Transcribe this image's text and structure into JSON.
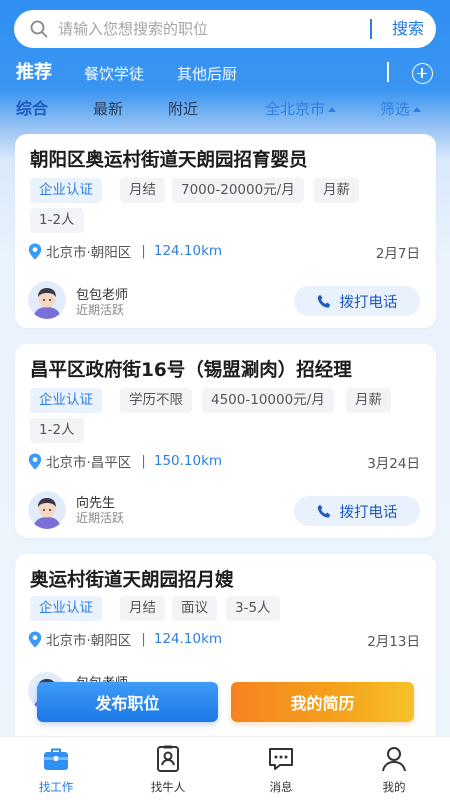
{
  "search": {
    "placeholder": "请输入您想搜索的职位",
    "button_label": "搜索"
  },
  "categories": [
    {
      "label": "推荐",
      "active": true
    },
    {
      "label": "餐饮学徒",
      "active": false
    },
    {
      "label": "其他后厨",
      "active": false
    }
  ],
  "filters": {
    "tabs": [
      "综合",
      "最新",
      "附近"
    ],
    "active_tab": "综合",
    "city": "全北京市",
    "screen": "筛选"
  },
  "jobs": [
    {
      "title": "朝阳区奥运村街道天朗园招育婴员",
      "tags": [
        "企业认证",
        "月结",
        "7000-20000元/月",
        "月薪",
        "1-2人"
      ],
      "location": "北京市·朝阳区",
      "distance": "124.10km",
      "date": "2月7日",
      "contact_name": "包包老师",
      "contact_status": "近期活跃",
      "call_label": "拨打电话"
    },
    {
      "title": "昌平区政府街16号（锡盟涮肉）招经理",
      "tags": [
        "企业认证",
        "学历不限",
        "4500-10000元/月",
        "月薪",
        "1-2人"
      ],
      "location": "北京市·昌平区",
      "distance": "150.10km",
      "date": "3月24日",
      "contact_name": "向先生",
      "contact_status": "近期活跃",
      "call_label": "拨打电话"
    },
    {
      "title": "奥运村街道天朗园招月嫂",
      "tags": [
        "企业认证",
        "月结",
        "面议",
        "3-5人"
      ],
      "location": "北京市·朝阳区",
      "distance": "124.10km",
      "date": "2月13日",
      "contact_name": "包包老师",
      "contact_status": "",
      "call_label": ""
    }
  ],
  "actions": {
    "publish": "发布职位",
    "resume": "我的简历"
  },
  "nav": [
    {
      "label": "找工作",
      "icon": "briefcase-icon",
      "active": true
    },
    {
      "label": "找牛人",
      "icon": "id-card-icon",
      "active": false
    },
    {
      "label": "消息",
      "icon": "chat-icon",
      "active": false
    },
    {
      "label": "我的",
      "icon": "user-icon",
      "active": false
    }
  ],
  "colors": {
    "primary": "#1f78e0",
    "accent_orange": "#f6821f",
    "header_blue": "#2f8ff3"
  }
}
